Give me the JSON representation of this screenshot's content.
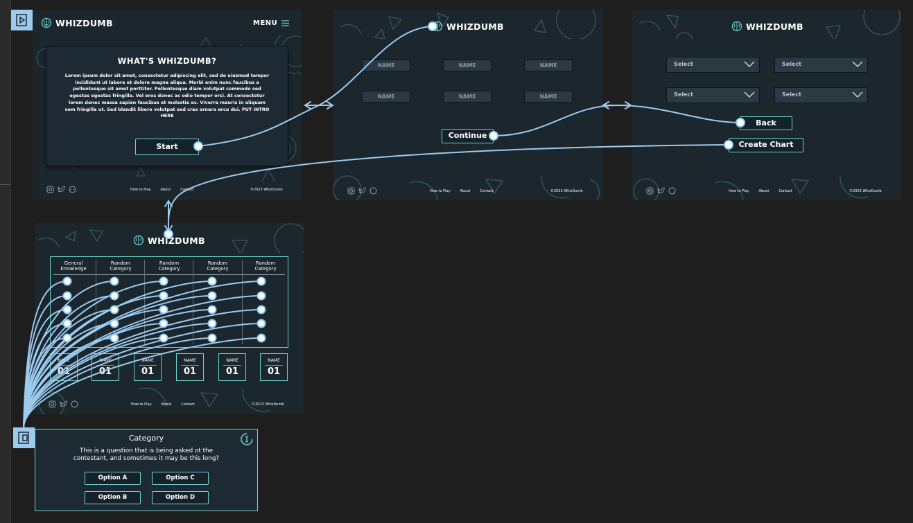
{
  "brand": "WHIZDUMB",
  "home": {
    "menu_label": "MENU",
    "card_title": "WHAT'S WHIZDUMB?",
    "card_body": "Lorem ipsum dolor sit amet, consectetur adipiscing elit, sed do eiusmod tempor incididunt ut labore et dolore magna aliqua. Morbi enim nunc faucibus a pellentesque sit amet porttitor. Pellentesque diam volutpat commodo sed egestas egestas fringilla. Vel eros donec ac odio tempor orci. At consectetur lorem donec massa sapien faucibus et molestie ac. Viverra mauris in aliquam sem fringilla ut. Sed blandit libero volutpat sed cras ornare arcu dui. PUT INTRO HERE",
    "start_label": "Start"
  },
  "footer": {
    "links": [
      "How to Play",
      "About",
      "Contact"
    ],
    "copyright": "©2023 WhizDumb"
  },
  "players": {
    "name_placeholder": "NAME",
    "continue_label": "Continue"
  },
  "categories_setup": {
    "select_placeholder": "Select",
    "back_label": "Back",
    "create_label": "Create Chart"
  },
  "board": {
    "columns": [
      {
        "line1": "General",
        "line2": "Knowledge"
      },
      {
        "line1": "Random",
        "line2": "Category"
      },
      {
        "line1": "Random",
        "line2": "Category"
      },
      {
        "line1": "Random",
        "line2": "Category"
      },
      {
        "line1": "Random",
        "line2": "Category"
      }
    ],
    "rows": 5,
    "players": [
      {
        "name": "NAME",
        "score": "01"
      },
      {
        "name": "NAME",
        "score": "01"
      },
      {
        "name": "NAME",
        "score": "01"
      },
      {
        "name": "NAME",
        "score": "01"
      },
      {
        "name": "NAME",
        "score": "01"
      },
      {
        "name": "NAME",
        "score": "01"
      }
    ]
  },
  "question": {
    "category": "Category",
    "text_line1": "This is a question that is being asked ot the",
    "text_line2": "contestant, and sometimes it may be this long?",
    "options": [
      "Option A",
      "Option C",
      "Option B",
      "Option D"
    ]
  },
  "colors": {
    "accent": "#6fd4d0",
    "wire": "#9ccbf0",
    "frame_bg": "#1b262d",
    "canvas_bg": "#1e1e1e"
  }
}
